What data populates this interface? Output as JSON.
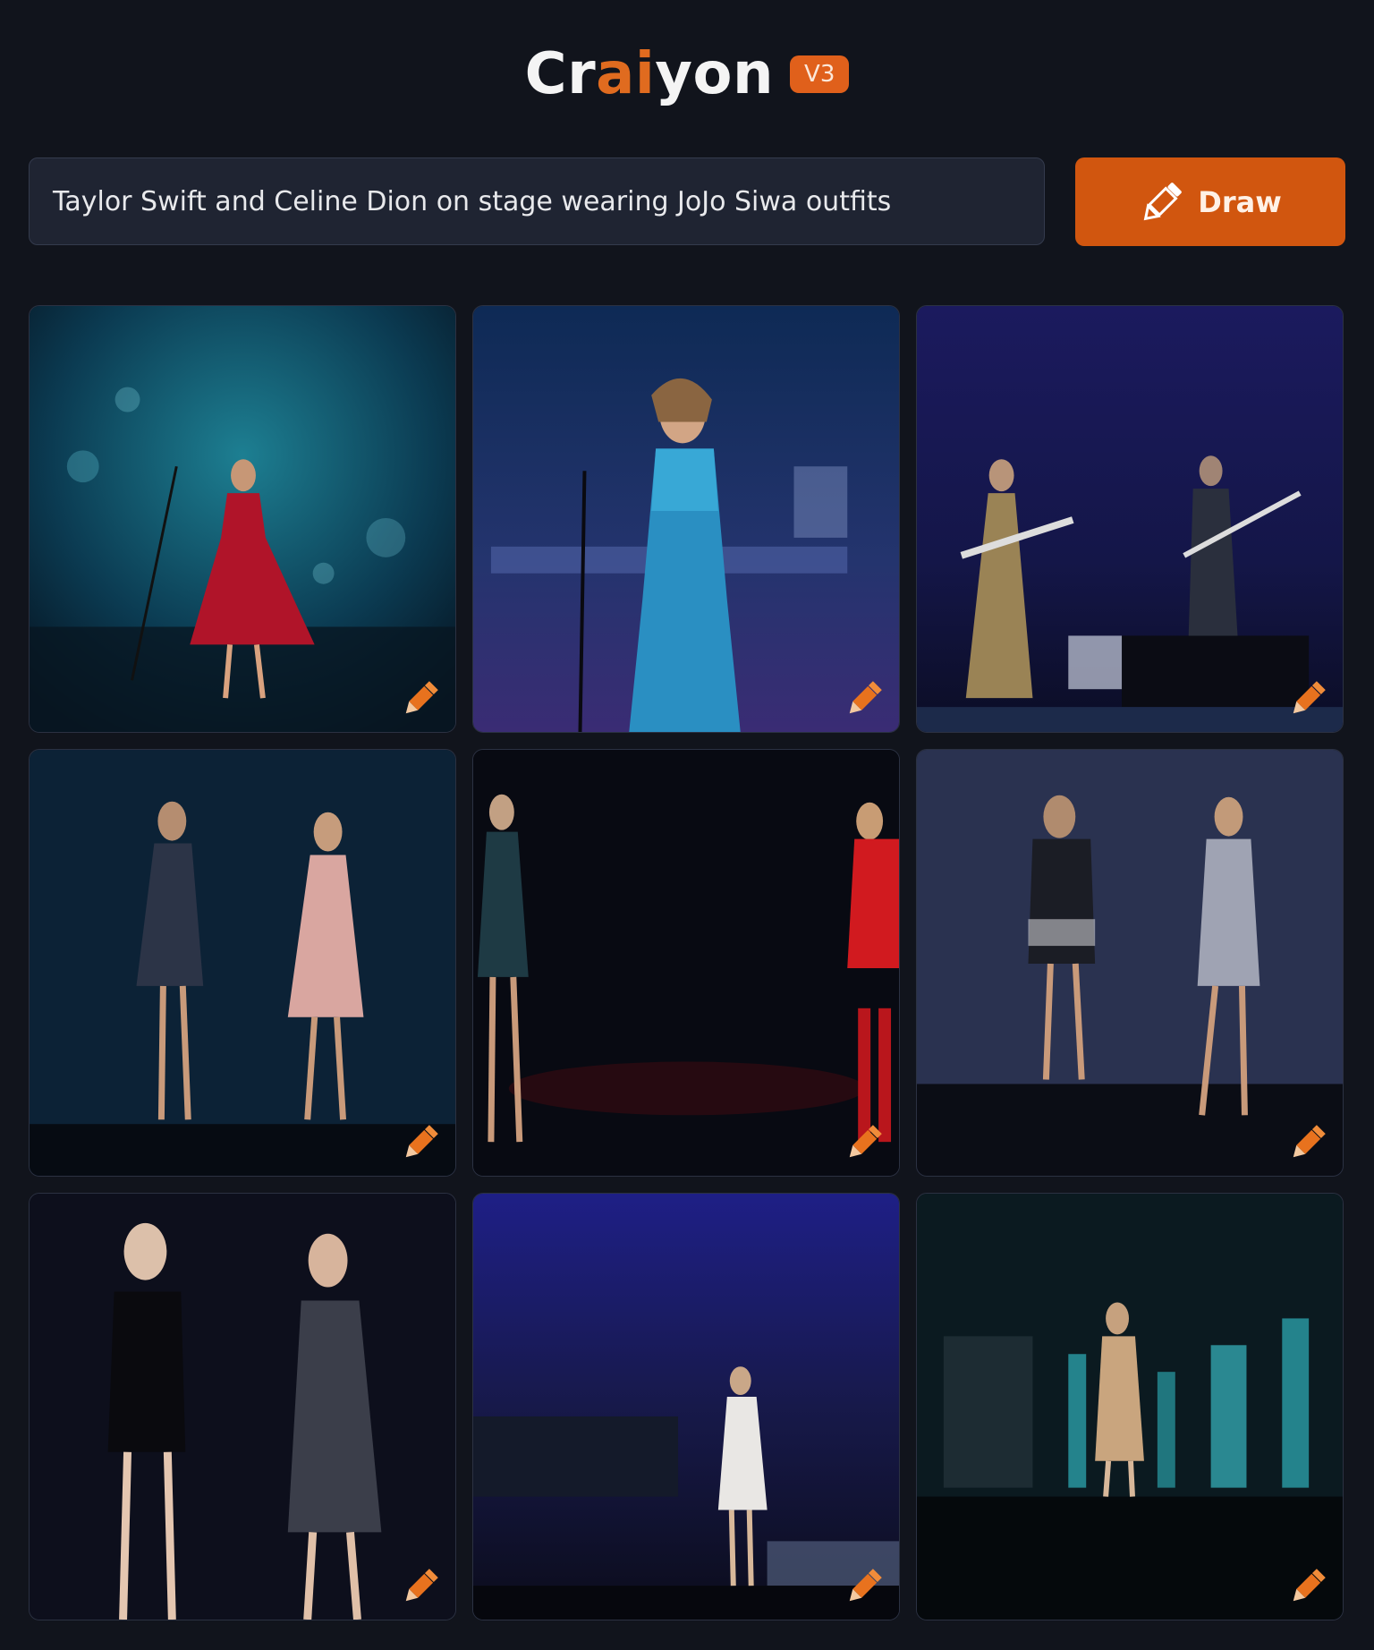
{
  "header": {
    "logo_part1": "Cr",
    "logo_part2": "ai",
    "logo_part3": "yon",
    "version_badge": "V3"
  },
  "prompt": {
    "value": "Taylor Swift and Celine Dion on stage wearing JoJo Siwa outfits"
  },
  "draw_button": {
    "label": "Draw",
    "icon": "pencil-icon"
  },
  "colors": {
    "background": "#11141c",
    "accent": "#d1560f",
    "input_bg": "#1f2432"
  },
  "results": {
    "edit_icon": "pencil-icon",
    "images": [
      {
        "description": "singer in red dress at microphone stand, teal bokeh lights"
      },
      {
        "description": "singer in blue sequin dress holding microphone"
      },
      {
        "description": "two performers with guitars on blue-lit stage"
      },
      {
        "description": "two performers in short sparkly dresses on dark stage"
      },
      {
        "description": "performer in black sequins and performer in red outfit with boots"
      },
      {
        "description": "two performers in silver and black mini dresses singing"
      },
      {
        "description": "two performers, one in black dress, one in sparkly dress with mic"
      },
      {
        "description": "performer in white dress on stage before audience"
      },
      {
        "description": "performer in beige dress on teal-lit stage"
      }
    ]
  }
}
